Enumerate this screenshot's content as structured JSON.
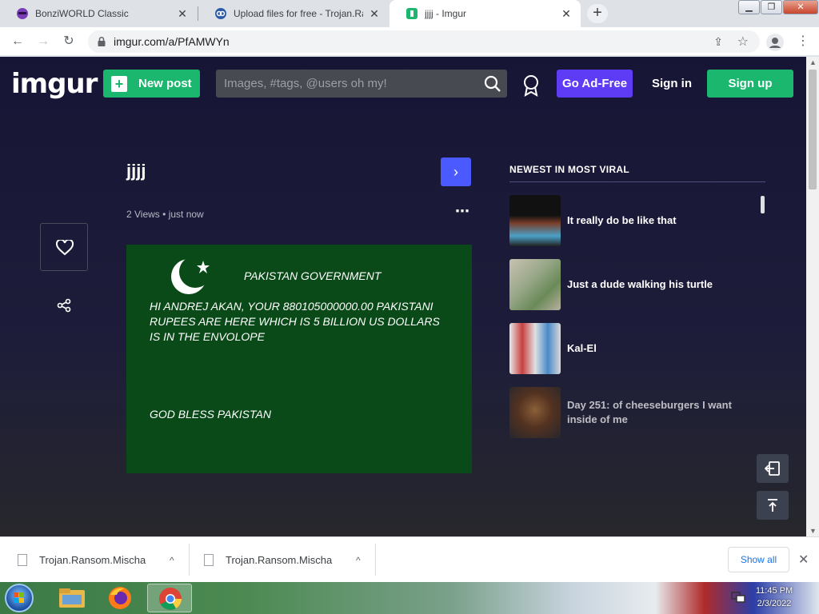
{
  "browser": {
    "tabs": [
      {
        "title": "BonziWORLD Classic"
      },
      {
        "title": "Upload files for free - Trojan.Ransom"
      },
      {
        "title": "jjjj - Imgur"
      }
    ],
    "url": "imgur.com/a/PfAMWYn",
    "new_tab_label": "+"
  },
  "imgur": {
    "logo": "imgur",
    "new_post_label": "New post",
    "search_placeholder": "Images, #tags, @users oh my!",
    "ad_free_label": "Go Ad-Free",
    "sign_in_label": "Sign in",
    "sign_up_label": "Sign up",
    "post": {
      "title": "jjjj",
      "views": "2 Views",
      "time": "just now",
      "image_text": {
        "heading": "PAKISTAN GOVERNMENT",
        "line1": "HI ANDREJ AKAN, YOUR 880105000000.00 PAKISTANI",
        "line2": "RUPEES ARE HERE WHICH IS 5 BILLION US DOLLARS",
        "line3": "IS IN THE ENVOLOPE",
        "closing": "GOD BLESS PAKISTAN"
      }
    },
    "sidebar": {
      "heading": "NEWEST IN MOST VIRAL",
      "items": [
        {
          "title": "It really do be like that"
        },
        {
          "title": "Just a dude walking his turtle"
        },
        {
          "title": "Kal-El"
        },
        {
          "title": "Day 251: of cheeseburgers I want inside of me"
        }
      ]
    }
  },
  "downloads": {
    "items": [
      {
        "name": "Trojan.Ransom.Mischa"
      },
      {
        "name": "Trojan.Ransom.Mischa"
      }
    ],
    "show_all_label": "Show all"
  },
  "taskbar": {
    "time": "11:45 PM",
    "date": "2/3/2022"
  },
  "colors": {
    "imgur_green": "#1bb76e",
    "ad_free_purple": "#5e3bf5",
    "next_blue": "#4a5aff",
    "image_green": "#0a4a18"
  }
}
